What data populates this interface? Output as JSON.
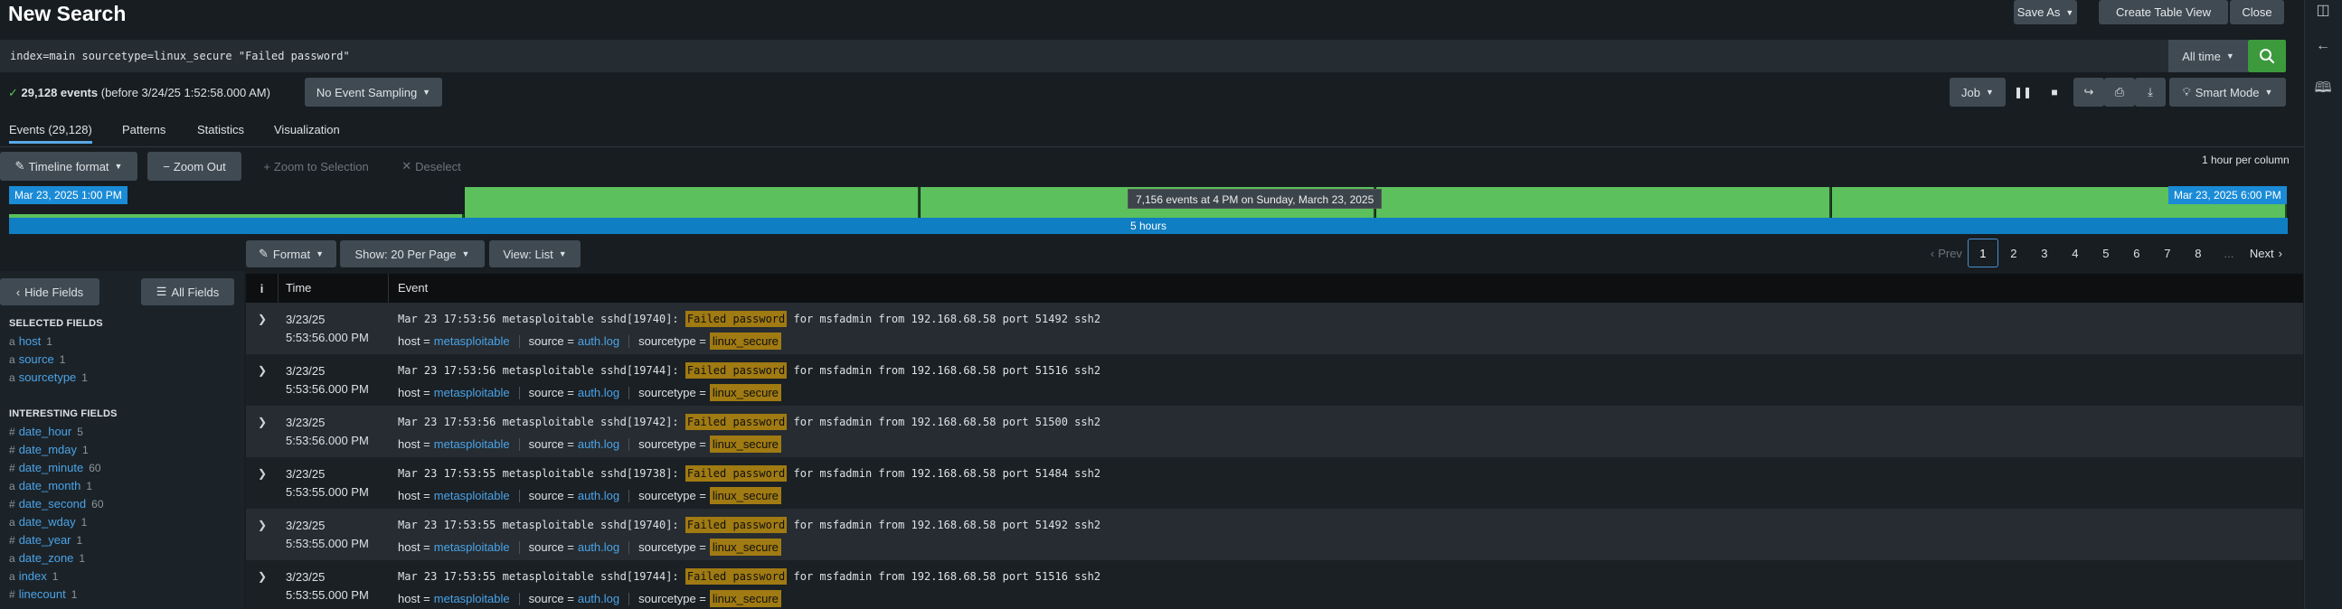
{
  "title": "New Search",
  "top_actions": {
    "save_as": "Save As",
    "create_table": "Create Table View",
    "close": "Close"
  },
  "search": {
    "query": "index=main sourcetype=linux_secure \"Failed password\"",
    "time_range": "All time"
  },
  "status": {
    "count": "29,128 events",
    "before": "(before 3/24/25 1:52:58.000 AM)",
    "sampling": "No Event Sampling"
  },
  "job": {
    "job_label": "Job",
    "mode_label": "Smart Mode"
  },
  "tabs": [
    {
      "label": "Events (29,128)"
    },
    {
      "label": "Patterns"
    },
    {
      "label": "Statistics"
    },
    {
      "label": "Visualization"
    }
  ],
  "timeline": {
    "format_label": "Timeline format",
    "zoom_out": "Zoom Out",
    "zoom_selection": "Zoom to Selection",
    "deselect": "Deselect",
    "per_column": "1 hour per column",
    "start_label": "Mar 23, 2025 1:00 PM",
    "end_label": "Mar 23, 2025 6:00 PM",
    "tooltip": "7,156 events at 4 PM on Sunday, March 23, 2025",
    "span_label": "5 hours",
    "column_levels": [
      0.1,
      1.0,
      1.0,
      1.0,
      1.0
    ]
  },
  "event_controls": {
    "format": "Format",
    "per_page": "Show: 20 Per Page",
    "view": "View: List"
  },
  "pagination": {
    "prev": "Prev",
    "pages": [
      "1",
      "2",
      "3",
      "4",
      "5",
      "6",
      "7",
      "8",
      "..."
    ],
    "next": "Next",
    "active": "1"
  },
  "sidebar": {
    "hide_fields": "Hide Fields",
    "all_fields": "All Fields",
    "selected_heading": "SELECTED FIELDS",
    "selected": [
      {
        "prefix": "a",
        "name": "host",
        "count": "1"
      },
      {
        "prefix": "a",
        "name": "source",
        "count": "1"
      },
      {
        "prefix": "a",
        "name": "sourcetype",
        "count": "1"
      }
    ],
    "interesting_heading": "INTERESTING FIELDS",
    "interesting": [
      {
        "prefix": "#",
        "name": "date_hour",
        "count": "5"
      },
      {
        "prefix": "#",
        "name": "date_mday",
        "count": "1"
      },
      {
        "prefix": "#",
        "name": "date_minute",
        "count": "60"
      },
      {
        "prefix": "a",
        "name": "date_month",
        "count": "1"
      },
      {
        "prefix": "#",
        "name": "date_second",
        "count": "60"
      },
      {
        "prefix": "a",
        "name": "date_wday",
        "count": "1"
      },
      {
        "prefix": "#",
        "name": "date_year",
        "count": "1"
      },
      {
        "prefix": "a",
        "name": "date_zone",
        "count": "1"
      },
      {
        "prefix": "a",
        "name": "index",
        "count": "1"
      },
      {
        "prefix": "#",
        "name": "linecount",
        "count": "1"
      }
    ]
  },
  "table": {
    "headers": {
      "info": "i",
      "time": "Time",
      "event": "Event"
    },
    "meta_keys": {
      "host": "host =",
      "source": "source =",
      "sourcetype": "sourcetype ="
    },
    "rows": [
      {
        "date": "3/23/25",
        "time": "5:53:56.000 PM",
        "pre": "Mar 23 17:53:56 metasploitable sshd[19740]: ",
        "hl": "Failed password",
        "post": " for msfadmin from 192.168.68.58 port 51492 ssh2",
        "host": "metasploitable",
        "source": "auth.log",
        "sourcetype": "linux_secure"
      },
      {
        "date": "3/23/25",
        "time": "5:53:56.000 PM",
        "pre": "Mar 23 17:53:56 metasploitable sshd[19744]: ",
        "hl": "Failed password",
        "post": " for msfadmin from 192.168.68.58 port 51516 ssh2",
        "host": "metasploitable",
        "source": "auth.log",
        "sourcetype": "linux_secure"
      },
      {
        "date": "3/23/25",
        "time": "5:53:56.000 PM",
        "pre": "Mar 23 17:53:56 metasploitable sshd[19742]: ",
        "hl": "Failed password",
        "post": " for msfadmin from 192.168.68.58 port 51500 ssh2",
        "host": "metasploitable",
        "source": "auth.log",
        "sourcetype": "linux_secure"
      },
      {
        "date": "3/23/25",
        "time": "5:53:55.000 PM",
        "pre": "Mar 23 17:53:55 metasploitable sshd[19738]: ",
        "hl": "Failed password",
        "post": " for msfadmin from 192.168.68.58 port 51484 ssh2",
        "host": "metasploitable",
        "source": "auth.log",
        "sourcetype": "linux_secure"
      },
      {
        "date": "3/23/25",
        "time": "5:53:55.000 PM",
        "pre": "Mar 23 17:53:55 metasploitable sshd[19740]: ",
        "hl": "Failed password",
        "post": " for msfadmin from 192.168.68.58 port 51492 ssh2",
        "host": "metasploitable",
        "source": "auth.log",
        "sourcetype": "linux_secure"
      },
      {
        "date": "3/23/25",
        "time": "5:53:55.000 PM",
        "pre": "Mar 23 17:53:55 metasploitable sshd[19744]: ",
        "hl": "Failed password",
        "post": " for msfadmin from 192.168.68.58 port 51516 ssh2",
        "host": "metasploitable",
        "source": "auth.log",
        "sourcetype": "linux_secure"
      }
    ]
  }
}
